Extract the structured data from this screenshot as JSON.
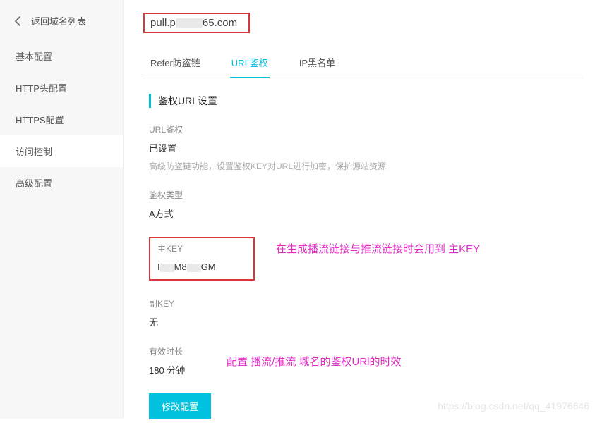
{
  "sidebar": {
    "back_label": "返回域名列表",
    "items": [
      {
        "label": "基本配置"
      },
      {
        "label": "HTTP头配置"
      },
      {
        "label": "HTTPS配置"
      },
      {
        "label": "访问控制"
      },
      {
        "label": "高级配置"
      }
    ],
    "active_index": 3
  },
  "header": {
    "domain_prefix": "pull.",
    "domain_masked": "p",
    "domain_suffix": "65.com"
  },
  "tabs": [
    {
      "label": "Refer防盗链"
    },
    {
      "label": "URL鉴权"
    },
    {
      "label": "IP黑名单"
    }
  ],
  "tabs_active_index": 1,
  "section": {
    "title": "鉴权URL设置",
    "fields": {
      "url_auth": {
        "label": "URL鉴权",
        "value": "已设置",
        "desc": "高级防盗链功能，设置鉴权KEY对URL进行加密，保护源站资源"
      },
      "auth_type": {
        "label": "鉴权类型",
        "value": "A方式"
      },
      "main_key": {
        "label": "主KEY",
        "value_prefix": "I",
        "value_mid": "M8",
        "value_suffix": "GM"
      },
      "sub_key": {
        "label": "副KEY",
        "value": "无"
      },
      "ttl": {
        "label": "有效时长",
        "value": "180 分钟"
      }
    },
    "button_label": "修改配置"
  },
  "annotations": {
    "key_note": "在生成播流链接与推流链接时会用到 主KEY",
    "ttl_note": "配置 播流/推流 域名的鉴权URl的时效"
  },
  "watermark": "https://blog.csdn.net/qq_41976646"
}
